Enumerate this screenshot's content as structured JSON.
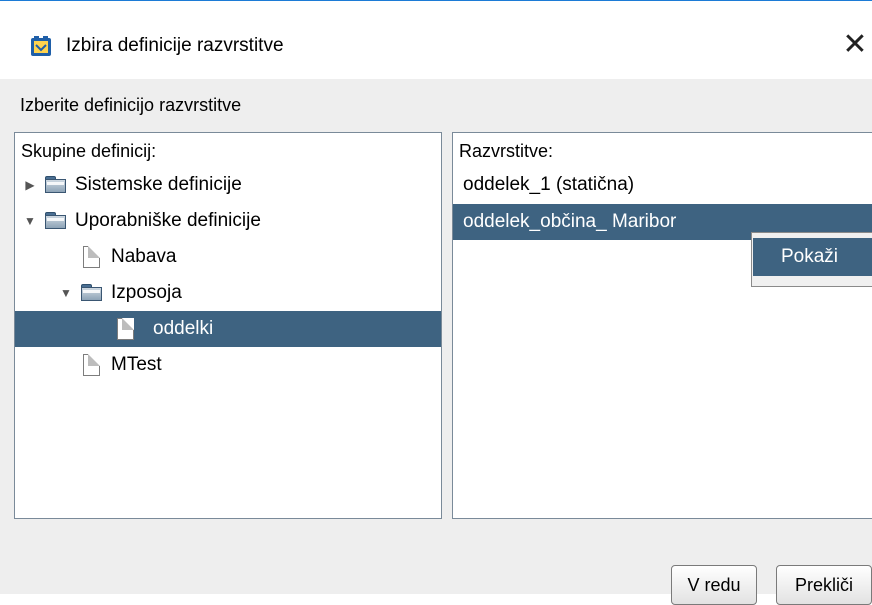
{
  "window": {
    "title": "Izbira definicije razvrstitve",
    "close_glyph": "✕"
  },
  "subtitle": "Izberite definicijo razvrstitve",
  "left_panel": {
    "header": "Skupine definicij:",
    "tree": [
      {
        "label": "Sistemske definicije",
        "type": "folder",
        "expanded": false,
        "level": 0
      },
      {
        "label": "Uporabniške definicije",
        "type": "folder",
        "expanded": true,
        "level": 0
      },
      {
        "label": "Nabava",
        "type": "document",
        "level": 1
      },
      {
        "label": "Izposoja",
        "type": "folder",
        "expanded": true,
        "level": 1
      },
      {
        "label": "oddelki",
        "type": "document",
        "level": 2,
        "selected": true
      },
      {
        "label": "MTest",
        "type": "document",
        "level": 1
      }
    ]
  },
  "right_panel": {
    "header": "Razvrstitve:",
    "items": [
      {
        "label": "oddelek_1 (statična)",
        "selected": false
      },
      {
        "label": "oddelek_občina_ Maribor",
        "selected": true
      }
    ]
  },
  "context_menu": {
    "items": [
      "Pokaži"
    ]
  },
  "buttons": {
    "ok": "V redu",
    "cancel": "Prekliči"
  },
  "colors": {
    "selection": "#3e6381",
    "window_border": "#1c7bd6",
    "background": "#eeeeee"
  }
}
